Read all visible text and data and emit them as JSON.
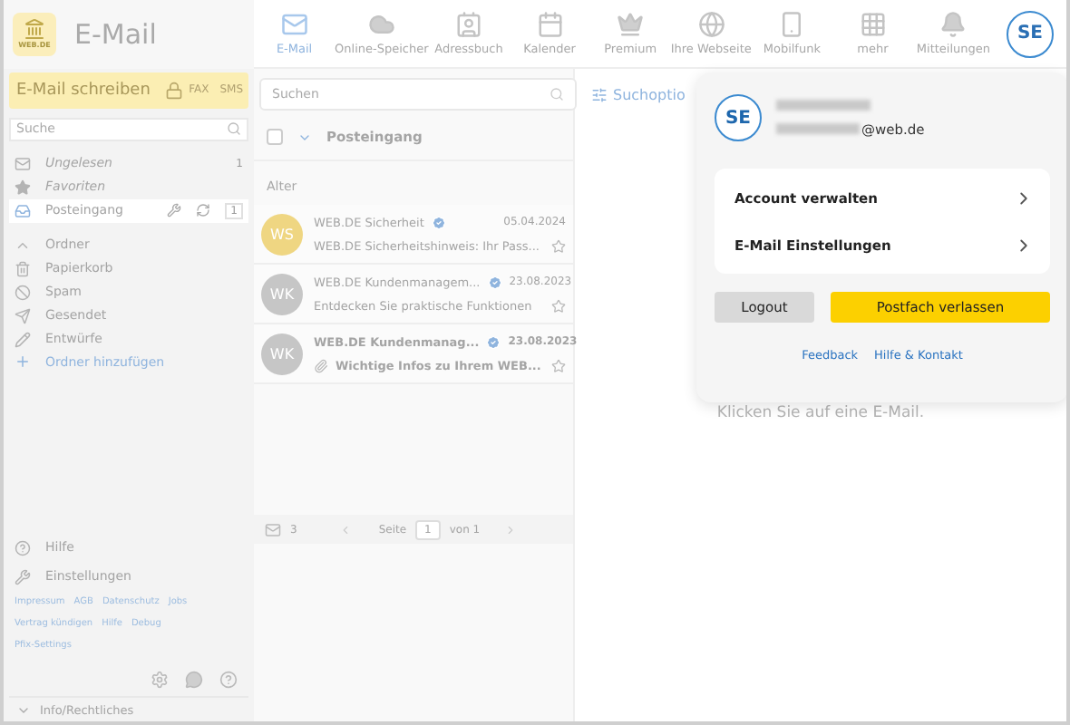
{
  "app": {
    "logo": "WEB.DE",
    "title": "E-Mail"
  },
  "nav": [
    {
      "label": "E-Mail",
      "selected": true
    },
    {
      "label": "Online-Speicher",
      "selected": false
    },
    {
      "label": "Adressbuch",
      "selected": false
    },
    {
      "label": "Kalender",
      "selected": false
    },
    {
      "label": "Premium",
      "selected": false
    },
    {
      "label": "Ihre Webseite",
      "selected": false
    },
    {
      "label": "Mobilfunk",
      "selected": false
    },
    {
      "label": "mehr",
      "selected": false
    },
    {
      "label": "Mitteilungen",
      "selected": false
    }
  ],
  "avatar": {
    "initials": "SE"
  },
  "sidebar": {
    "compose": "E-Mail schreiben",
    "compose_extras": [
      "FAX",
      "SMS"
    ],
    "search_placeholder": "Suche",
    "items": [
      {
        "kind": "filter",
        "label": "Ungelesen",
        "count": "1",
        "selected": false
      },
      {
        "kind": "filter",
        "label": "Favoriten",
        "selected": false
      },
      {
        "kind": "inbox",
        "label": "Posteingang",
        "count": "1",
        "selected": true
      },
      {
        "kind": "group",
        "label": "Ordner",
        "expanded": true,
        "selected": false
      },
      {
        "kind": "folder",
        "label": "Papierkorb",
        "selected": false
      },
      {
        "kind": "folder",
        "label": "Spam",
        "selected": false
      },
      {
        "kind": "folder",
        "label": "Gesendet",
        "selected": false
      },
      {
        "kind": "folder",
        "label": "Entwürfe",
        "selected": false
      },
      {
        "kind": "add",
        "label": "Ordner hinzufügen",
        "selected": false
      }
    ],
    "help_items": [
      "Hilfe",
      "Einstellungen"
    ],
    "footer_links": [
      {
        "links": [
          "Impressum",
          "AGB",
          "Datenschutz",
          "Jobs"
        ]
      },
      {
        "links": [
          "Vertrag kündigen",
          "Hilfe",
          "Debug"
        ]
      },
      {
        "links": [
          "Pfix-Settings"
        ]
      }
    ],
    "info": {
      "label": "Info/Rechtliches",
      "expanded": false
    }
  },
  "mail_list": {
    "search_placeholder": "Suchen",
    "search_options": "Suchoptio",
    "select_all": {
      "checked": false
    },
    "folder": "Posteingang",
    "group": "Alter",
    "mails": [
      {
        "initials": "WS",
        "color": "#efd682",
        "sender": "WEB.DE Sicherheit",
        "date": "05.04.2024",
        "subject": "WEB.DE Sicherheitshinweis: Ihr Pass...",
        "unread": false,
        "attachment": false
      },
      {
        "initials": "WK",
        "color": "#c6c6c6",
        "sender": "WEB.DE Kundenmanagem...",
        "date": "23.08.2023",
        "subject": "Entdecken Sie praktische Funktionen",
        "unread": false,
        "attachment": false
      },
      {
        "initials": "WK",
        "color": "#c6c6c6",
        "sender": "WEB.DE Kundenmanag...",
        "date": "23.08.2023",
        "subject": "Wichtige Infos zu Ihrem WEB...",
        "unread": true,
        "attachment": true
      }
    ],
    "count": "3",
    "page_label": "Seite",
    "page": "1",
    "page_total": "von 1"
  },
  "reading": {
    "hint": "Klicken Sie auf eine E-Mail."
  },
  "popover": {
    "initials": "SE",
    "email": "@web.de",
    "menu": [
      "Account verwalten",
      "E-Mail Einstellungen"
    ],
    "logout": "Logout",
    "leave": "Postfach verlassen",
    "links": [
      "Feedback",
      "Hilfe & Kontakt"
    ]
  }
}
